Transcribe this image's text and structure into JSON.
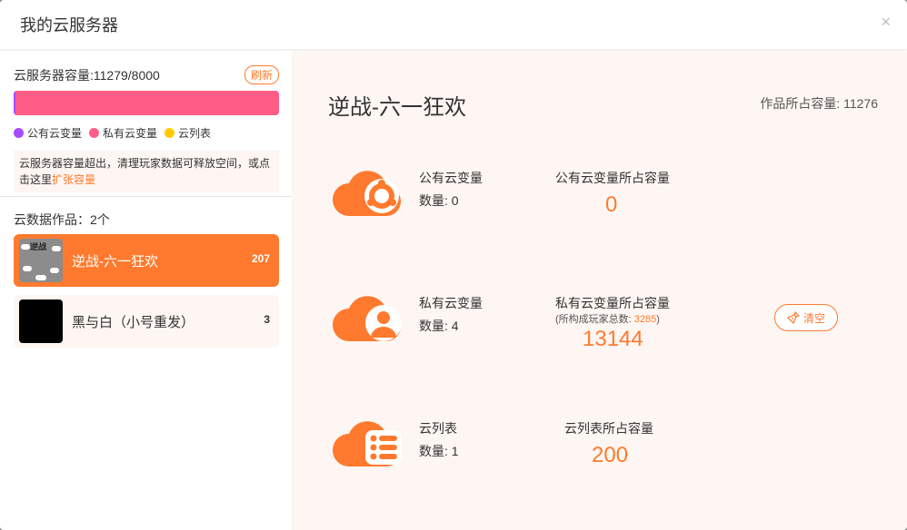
{
  "header": {
    "title": "我的云服务器",
    "close_glyph": "×"
  },
  "capacity": {
    "label": "云服务器容量:11279/8000",
    "refresh_label": "刷新",
    "used": 11279,
    "total": 8000,
    "public_fraction": 0.008,
    "colors": {
      "public": "#a64bff",
      "private": "#ff5d87",
      "list": "#ffcc00"
    }
  },
  "legend": [
    {
      "label": "公有云变量",
      "color": "#a64bff"
    },
    {
      "label": "私有云变量",
      "color": "#ff5d87"
    },
    {
      "label": "云列表",
      "color": "#ffcc00"
    }
  ],
  "warning": {
    "text": "云服务器容量超出，清理玩家数据可释放空间，或点击这里",
    "link": "扩张容量"
  },
  "works": {
    "title": "云数据作品：2个",
    "items": [
      {
        "name": "逆战-六一狂欢",
        "count": "207",
        "thumb_text": "逆战"
      },
      {
        "name": "黑与白（小号重发）",
        "count": "3"
      }
    ]
  },
  "detail": {
    "title": "逆战-六一狂欢",
    "capacity": "作品所占容量: 11276",
    "public": {
      "label": "公有云变量",
      "count": "数量: 0",
      "size_label": "公有云变量所占容量",
      "size": "0"
    },
    "private": {
      "label": "私有云变量",
      "count": "数量: 4",
      "size_label": "私有云变量所占容量",
      "sub_prefix": "(所构成玩家总数: ",
      "sub_num": "3285",
      "sub_suffix": ")",
      "size": "13144",
      "clear_label": "清空"
    },
    "list": {
      "label": "云列表",
      "count": "数量: 1",
      "size_label": "云列表所占容量",
      "size": "200"
    }
  },
  "accent": "#ff7a2e"
}
